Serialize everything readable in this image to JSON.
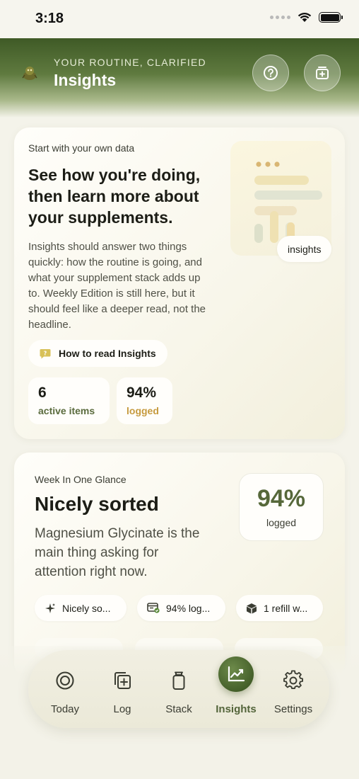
{
  "status_bar": {
    "time": "3:18"
  },
  "header": {
    "eyebrow": "YOUR ROUTINE, CLARIFIED",
    "title": "Insights"
  },
  "hero": {
    "eyebrow": "Start with your own data",
    "heading": "See how you're doing, then learn more about your supplements.",
    "body": "Insights should answer two things quickly: how the routine is going, and what your supplement stack adds up to. Weekly Edition is still here, but it should feel like a deeper read, not the headline.",
    "illustration_badge": "insights",
    "how_to_read": "How to read Insights",
    "stats": [
      {
        "value": "6",
        "label": "active items",
        "color": "#5a6b3d"
      },
      {
        "value": "94%",
        "label": "logged",
        "color": "#c69a3e"
      }
    ]
  },
  "week": {
    "eyebrow": "Week In One Glance",
    "title": "Nicely sorted",
    "body": "Magnesium Glycinate is the main thing asking for attention right now.",
    "percent": "94%",
    "percent_label": "logged",
    "chips": [
      {
        "label": "Nicely so...",
        "icon": "sparkle-icon"
      },
      {
        "label": "94% log...",
        "icon": "calendar-check-icon"
      },
      {
        "label": "1 refill w...",
        "icon": "package-icon"
      }
    ]
  },
  "tabbar": {
    "tabs": [
      {
        "label": "Today",
        "icon": "target-icon",
        "active": false
      },
      {
        "label": "Log",
        "icon": "add-layers-icon",
        "active": false
      },
      {
        "label": "Stack",
        "icon": "jar-icon",
        "active": false
      },
      {
        "label": "Insights",
        "icon": "trend-chart-icon",
        "active": true
      },
      {
        "label": "Settings",
        "icon": "gear-icon",
        "active": false
      }
    ]
  },
  "colors": {
    "accent_green": "#56683a",
    "accent_gold": "#c69a3e",
    "header_green": "#3f5a26"
  }
}
